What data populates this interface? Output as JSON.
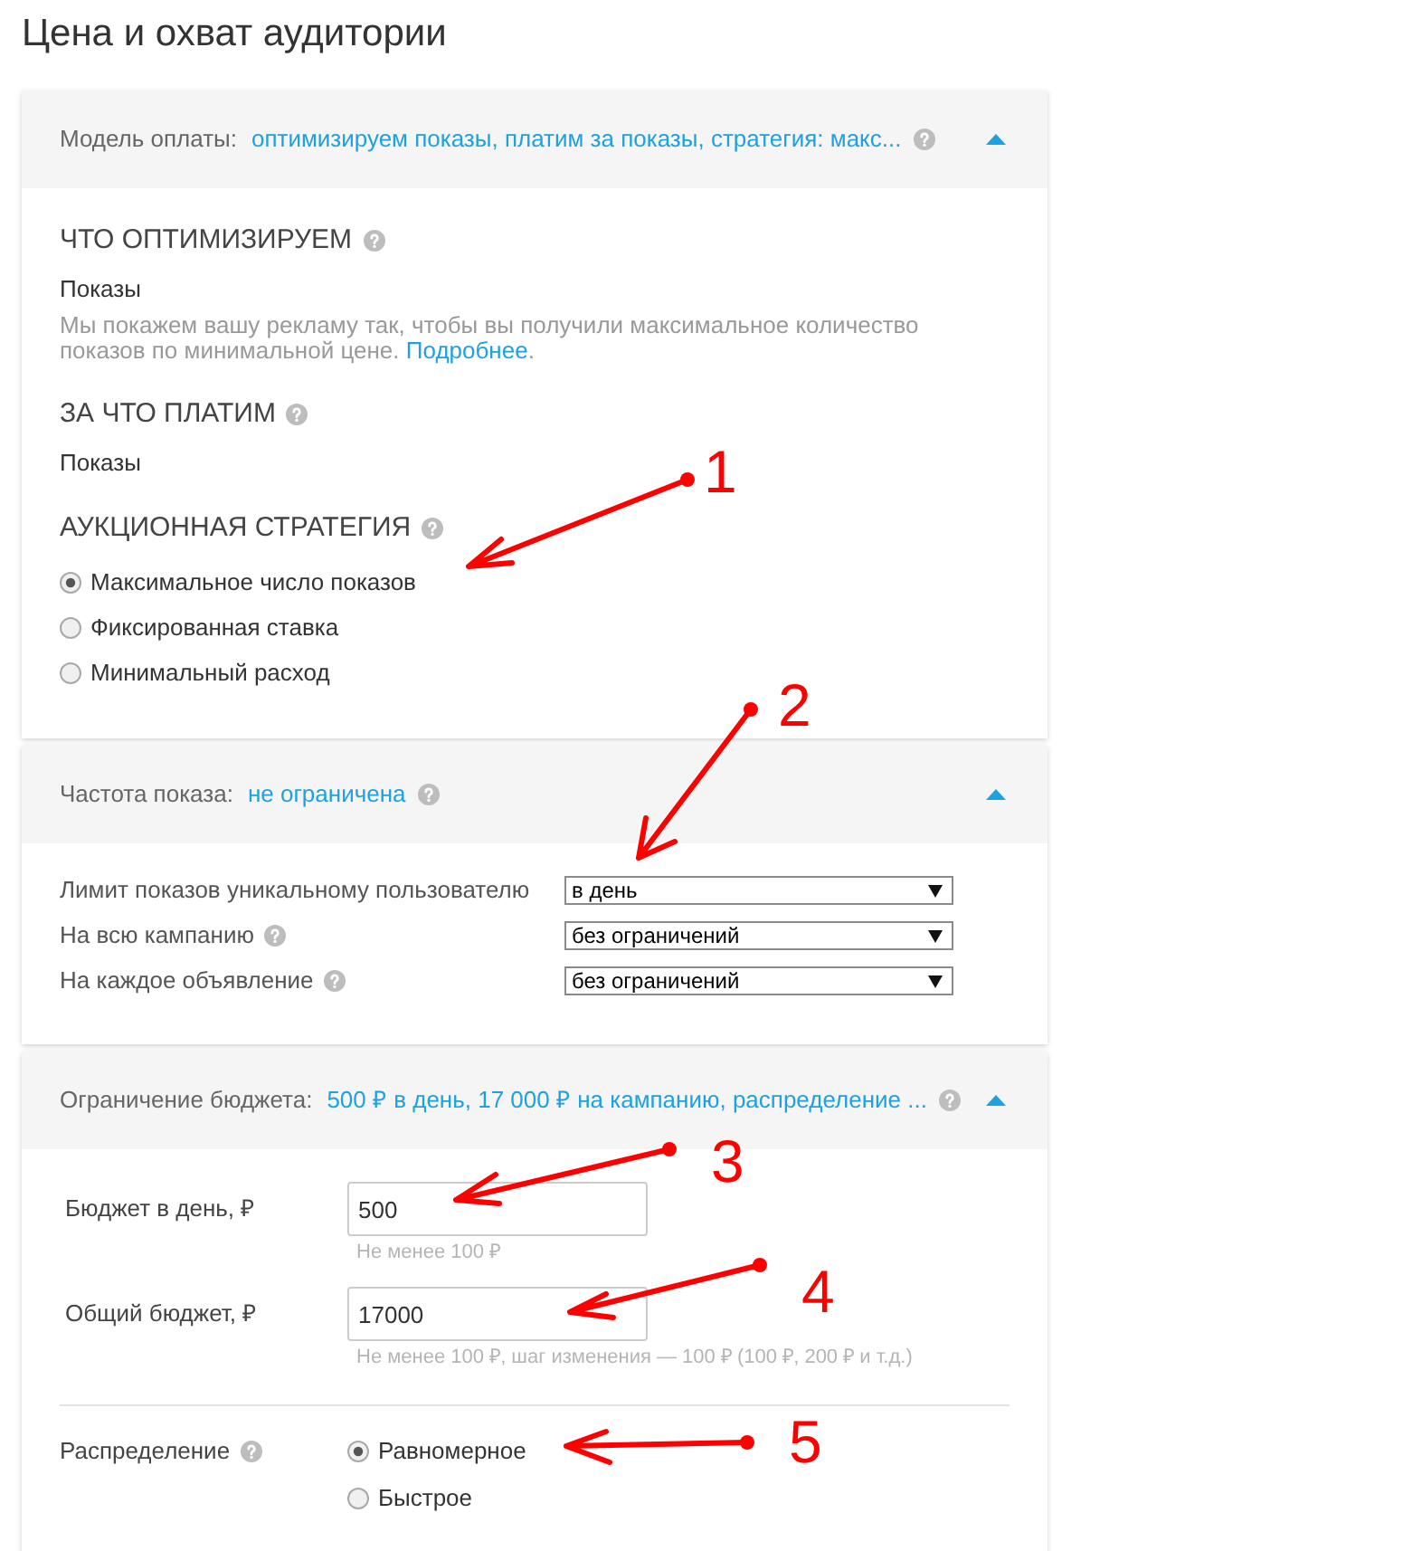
{
  "title": "Цена и охват аудитории",
  "sections": [
    {
      "kind": "payment",
      "label": "Модель оплаты:",
      "summary": "оптимизируем показы, платим за показы, стратегия: макс...",
      "help": true,
      "expanded": true,
      "blocks": [
        {
          "kind": "value",
          "heading": "ЧТО ОПТИМИЗИРУЕМ",
          "help": true,
          "value": "Показы",
          "description": "Мы покажем вашу рекламу так, чтобы вы получили максимальное количество показов по минимальной цене.",
          "link": "Подробнее",
          "link_suffix": "."
        },
        {
          "kind": "value",
          "heading": "ЗА ЧТО ПЛАТИМ",
          "help": true,
          "value": "Показы"
        },
        {
          "kind": "radio",
          "heading": "АУКЦИОННАЯ СТРАТЕГИЯ",
          "help": true,
          "options": [
            {
              "label": "Максимальное число показов",
              "selected": true
            },
            {
              "label": "Фиксированная ставка",
              "selected": false
            },
            {
              "label": "Минимальный расход",
              "selected": false
            }
          ]
        }
      ]
    },
    {
      "kind": "frequency",
      "label": "Частота показа:",
      "summary": "не ограничена",
      "help": true,
      "expanded": true,
      "rows": [
        {
          "label": "Лимит показов уникальному пользователю",
          "help": false,
          "value": "в день"
        },
        {
          "label": "На всю кампанию",
          "help": true,
          "value": "без ограничений"
        },
        {
          "label": "На каждое объявление",
          "help": true,
          "value": "без ограничений"
        }
      ]
    },
    {
      "kind": "budget",
      "label": "Ограничение бюджета:",
      "summary": "500 ₽ в день, 17 000 ₽ на кампанию, распределение ...",
      "help": true,
      "expanded": true,
      "fields": [
        {
          "label": "Бюджет в день, ₽",
          "value": "500",
          "hint": "Не менее 100 ₽"
        },
        {
          "label": "Общий бюджет, ₽",
          "value": "17000",
          "hint": "Не менее 100 ₽, шаг изменения — 100 ₽ (100 ₽, 200 ₽ и т.д.)"
        }
      ],
      "distribution": {
        "label": "Распределение",
        "help": true,
        "options": [
          {
            "label": "Равномерное",
            "selected": true
          },
          {
            "label": "Быстрое",
            "selected": false
          }
        ]
      }
    }
  ],
  "annotations": [
    {
      "number": "1"
    },
    {
      "number": "2"
    },
    {
      "number": "3"
    },
    {
      "number": "4"
    },
    {
      "number": "5"
    }
  ]
}
